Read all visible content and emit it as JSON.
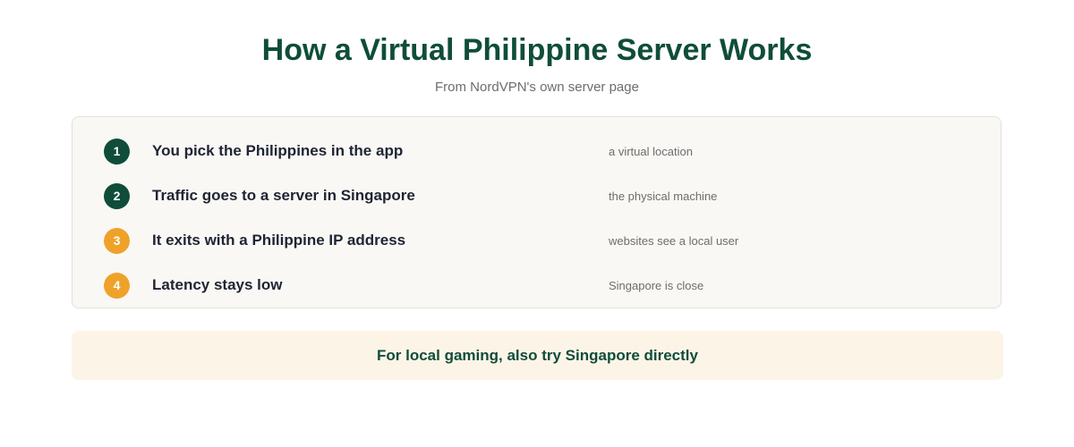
{
  "header": {
    "title": "How a Virtual Philippine Server Works",
    "subtitle": "From NordVPN's own server page"
  },
  "steps": [
    {
      "number": "1",
      "label": "You pick the Philippines in the app",
      "note": "a virtual location",
      "badge_color": "#0f4d3a"
    },
    {
      "number": "2",
      "label": "Traffic goes to a server in Singapore",
      "note": "the physical machine",
      "badge_color": "#0f4d3a"
    },
    {
      "number": "3",
      "label": "It exits with a Philippine IP address",
      "note": "websites see a local user",
      "badge_color": "#efa22a"
    },
    {
      "number": "4",
      "label": "Latency stays low",
      "note": "Singapore is close",
      "badge_color": "#efa22a"
    }
  ],
  "tip": {
    "text": "For local gaming, also try Singapore directly"
  },
  "colors": {
    "accent_green": "#0f4d3a",
    "accent_orange": "#efa22a",
    "tip_background": "#fdf4e8"
  }
}
